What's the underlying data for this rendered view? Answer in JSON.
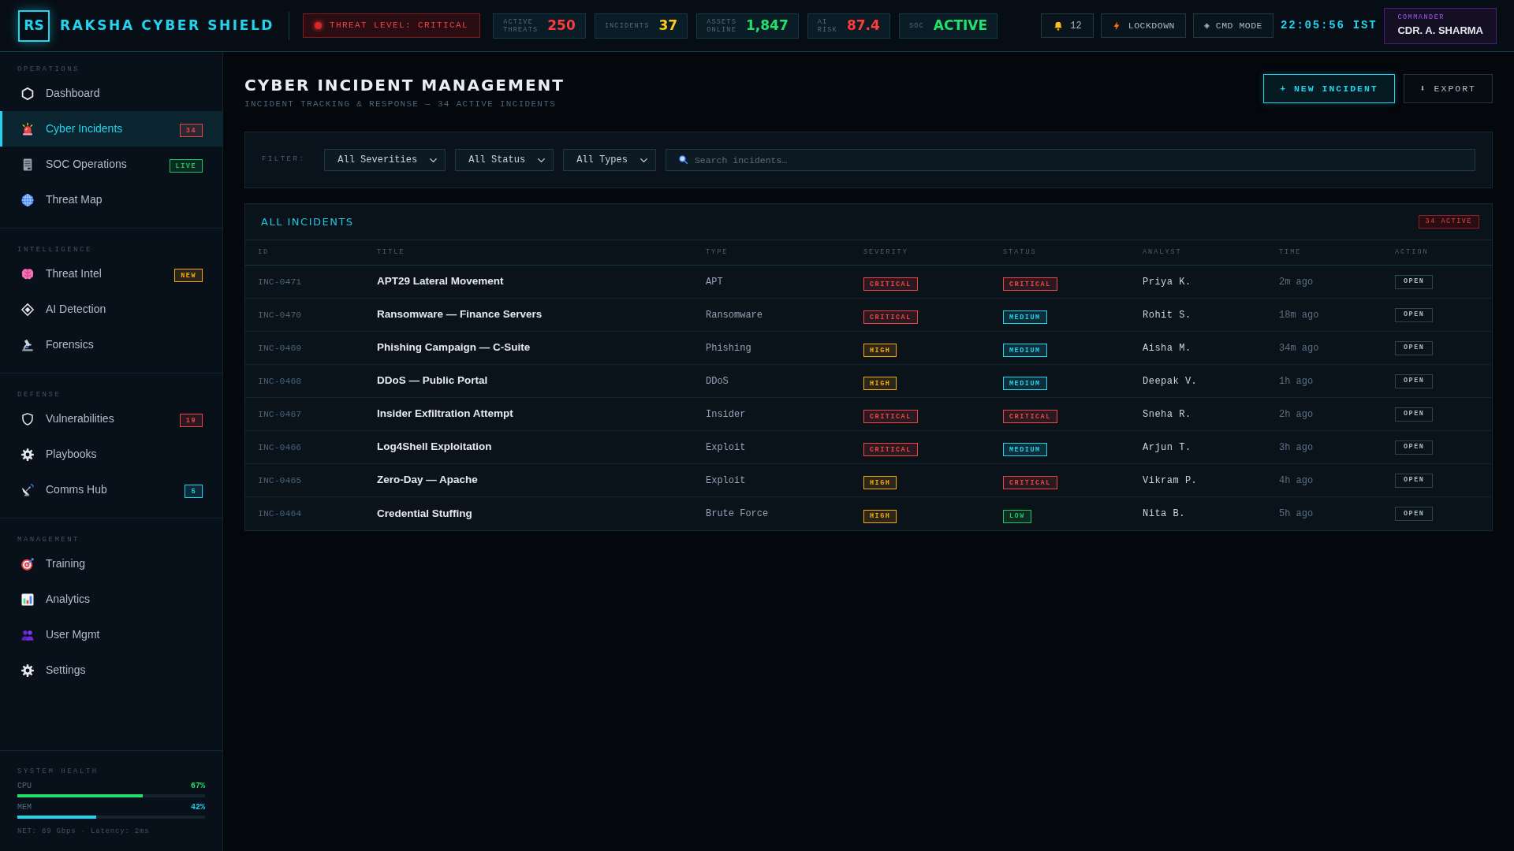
{
  "header": {
    "logo_mark": "RS",
    "title": "RAKSHA CYBER SHIELD",
    "threat_level": "THREAT LEVEL: CRITICAL",
    "stats": [
      {
        "label": "ACTIVE THREATS",
        "value": "250",
        "color": "#ff3b3b"
      },
      {
        "label": "INCIDENTS",
        "value": "37",
        "color": "#facc15"
      },
      {
        "label": "ASSETS ONLINE",
        "value": "1,847",
        "color": "#22e06b"
      },
      {
        "label": "AI RISK",
        "value": "87.4",
        "color": "#ff3b3b"
      },
      {
        "label": "SOC",
        "value": "ACTIVE",
        "color": "#22e06b"
      }
    ],
    "notifications": "12",
    "lockdown": "LOCKDOWN",
    "cmd_mode": "◈ CMD MODE",
    "clock": "22:05:56 IST",
    "user": {
      "role": "COMMANDER",
      "name": "CDR. A. SHARMA"
    }
  },
  "sidebar": {
    "sections": [
      {
        "label": "OPERATIONS",
        "items": [
          {
            "label": "Dashboard",
            "selected": false
          },
          {
            "label": "Cyber Incidents",
            "selected": true,
            "badge": {
              "text": "34",
              "color": "#ef4444"
            }
          },
          {
            "label": "SOC Operations",
            "selected": false,
            "badge": {
              "text": "LIVE",
              "color": "#22c55e"
            }
          },
          {
            "label": "Threat Map",
            "selected": false
          }
        ]
      },
      {
        "label": "INTELLIGENCE",
        "items": [
          {
            "label": "Threat Intel",
            "selected": false,
            "badge": {
              "text": "NEW",
              "color": "#f5a70b"
            }
          },
          {
            "label": "AI Detection",
            "selected": false
          },
          {
            "label": "Forensics",
            "selected": false
          }
        ]
      },
      {
        "label": "DEFENSE",
        "items": [
          {
            "label": "Vulnerabilities",
            "selected": false,
            "badge": {
              "text": "19",
              "color": "#ef4444"
            }
          },
          {
            "label": "Playbooks",
            "selected": false
          },
          {
            "label": "Comms Hub",
            "selected": false,
            "badge": {
              "text": "5",
              "color": "#22d3ee"
            }
          }
        ]
      },
      {
        "label": "MANAGEMENT",
        "items": [
          {
            "label": "Training",
            "selected": false
          },
          {
            "label": "Analytics",
            "selected": false
          },
          {
            "label": "User Mgmt",
            "selected": false
          },
          {
            "label": "Settings",
            "selected": false
          }
        ]
      }
    ],
    "system_health": {
      "title": "SYSTEM HEALTH",
      "meters": [
        {
          "label": "CPU",
          "reading": "67%",
          "level": 0.67,
          "color": "#22e06b"
        },
        {
          "label": "MEM",
          "reading": "42%",
          "level": 0.42,
          "color": "#22d3ee"
        }
      ],
      "network": "NET: 89 Gbps · Latency: 2ms"
    }
  },
  "page": {
    "title": "CYBER INCIDENT MANAGEMENT",
    "subtitle": "INCIDENT TRACKING & RESPONSE — 34 ACTIVE INCIDENTS",
    "buttons": [
      {
        "label": "+ NEW INCIDENT",
        "kind": "primary"
      },
      {
        "label": "⬇ EXPORT",
        "kind": "secondary"
      }
    ]
  },
  "filters": {
    "label": "FILTER:",
    "selects": [
      {
        "value": "All Severities"
      },
      {
        "value": "All Status"
      },
      {
        "value": "All Types"
      }
    ],
    "search": {
      "placeholder": "Search incidents…"
    }
  },
  "table": {
    "title": "ALL INCIDENTS",
    "badge": "34 ACTIVE",
    "columns": [
      "ID",
      "TITLE",
      "TYPE",
      "SEVERITY",
      "STATUS",
      "ANALYST",
      "TIME",
      "ACTION"
    ],
    "rows": [
      {
        "id": "INC-0471",
        "title": "APT29 Lateral Movement",
        "type": "APT",
        "severity": {
          "text": "CRITICAL",
          "color": "#ef4444"
        },
        "status": {
          "text": "CRITICAL",
          "color": "#ef4444"
        },
        "analyst": "Priya K.",
        "time": "2m ago",
        "action": "OPEN"
      },
      {
        "id": "INC-0470",
        "title": "Ransomware — Finance Servers",
        "type": "Ransomware",
        "severity": {
          "text": "CRITICAL",
          "color": "#ef4444"
        },
        "status": {
          "text": "MEDIUM",
          "color": "#22d3ee"
        },
        "analyst": "Rohit S.",
        "time": "18m ago",
        "action": "OPEN"
      },
      {
        "id": "INC-0469",
        "title": "Phishing Campaign — C-Suite",
        "type": "Phishing",
        "severity": {
          "text": "HIGH",
          "color": "#f5a70b"
        },
        "status": {
          "text": "MEDIUM",
          "color": "#22d3ee"
        },
        "analyst": "Aisha M.",
        "time": "34m ago",
        "action": "OPEN"
      },
      {
        "id": "INC-0468",
        "title": "DDoS — Public Portal",
        "type": "DDoS",
        "severity": {
          "text": "HIGH",
          "color": "#f5a70b"
        },
        "status": {
          "text": "MEDIUM",
          "color": "#22d3ee"
        },
        "analyst": "Deepak V.",
        "time": "1h ago",
        "action": "OPEN"
      },
      {
        "id": "INC-0467",
        "title": "Insider Exfiltration Attempt",
        "type": "Insider",
        "severity": {
          "text": "CRITICAL",
          "color": "#ef4444"
        },
        "status": {
          "text": "CRITICAL",
          "color": "#ef4444"
        },
        "analyst": "Sneha R.",
        "time": "2h ago",
        "action": "OPEN"
      },
      {
        "id": "INC-0466",
        "title": "Log4Shell Exploitation",
        "type": "Exploit",
        "severity": {
          "text": "CRITICAL",
          "color": "#ef4444"
        },
        "status": {
          "text": "MEDIUM",
          "color": "#22d3ee"
        },
        "analyst": "Arjun T.",
        "time": "3h ago",
        "action": "OPEN"
      },
      {
        "id": "INC-0465",
        "title": "Zero-Day — Apache",
        "type": "Exploit",
        "severity": {
          "text": "HIGH",
          "color": "#f5a70b"
        },
        "status": {
          "text": "CRITICAL",
          "color": "#ef4444"
        },
        "analyst": "Vikram P.",
        "time": "4h ago",
        "action": "OPEN"
      },
      {
        "id": "INC-0464",
        "title": "Credential Stuffing",
        "type": "Brute Force",
        "severity": {
          "text": "HIGH",
          "color": "#f5a70b"
        },
        "status": {
          "text": "LOW",
          "color": "#22c55e"
        },
        "analyst": "Nita B.",
        "time": "5h ago",
        "action": "OPEN"
      }
    ]
  }
}
